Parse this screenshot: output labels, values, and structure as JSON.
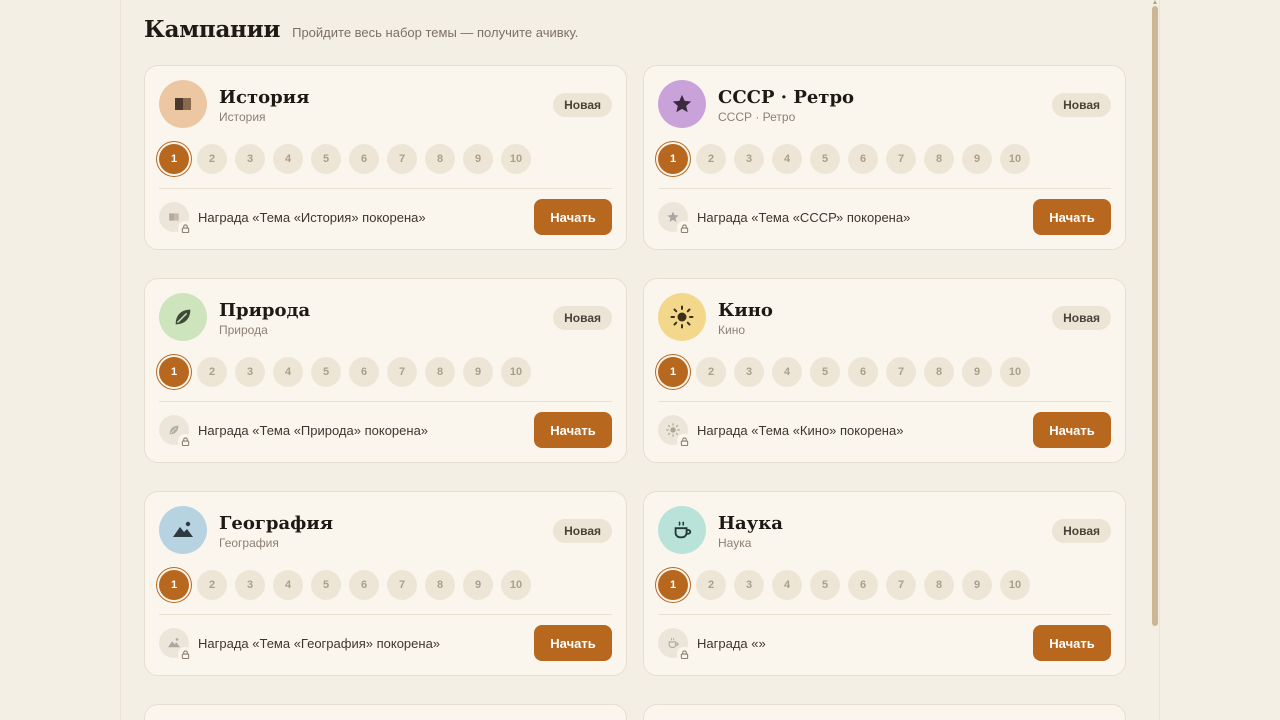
{
  "header": {
    "title": "Кампании",
    "subtitle": "Пройдите весь набор темы — получите ачивку."
  },
  "levels": [
    "1",
    "2",
    "3",
    "4",
    "5",
    "6",
    "7",
    "8",
    "9",
    "10"
  ],
  "cards": [
    {
      "title": "История",
      "subtitle": "История",
      "badge": "Новая",
      "icon": "book-icon",
      "icon_bg": "#ecc7a2",
      "reward": "Награда «Тема «История» покорена»",
      "button": "Начать"
    },
    {
      "title": "СССР · Ретро",
      "subtitle": "СССР · Ретро",
      "badge": "Новая",
      "icon": "star-icon",
      "icon_bg": "#c9a2d9",
      "reward": "Награда «Тема «СССР» покорена»",
      "button": "Начать"
    },
    {
      "title": "Природа",
      "subtitle": "Природа",
      "badge": "Новая",
      "icon": "leaf-icon",
      "icon_bg": "#cde4bd",
      "reward": "Награда «Тема «Природа» покорена»",
      "button": "Начать"
    },
    {
      "title": "Кино",
      "subtitle": "Кино",
      "badge": "Новая",
      "icon": "sun-icon",
      "icon_bg": "#f3d88c",
      "reward": "Награда «Тема «Кино» покорена»",
      "button": "Начать"
    },
    {
      "title": "География",
      "subtitle": "География",
      "badge": "Новая",
      "icon": "mountain-icon",
      "icon_bg": "#b7d3e2",
      "reward": "Награда «Тема «География» покорена»",
      "button": "Начать"
    },
    {
      "title": "Наука",
      "subtitle": "Наука",
      "badge": "Новая",
      "icon": "cup-icon",
      "icon_bg": "#b9e3d9",
      "reward": "Награда «»",
      "button": "Начать"
    }
  ],
  "colors": {
    "accent": "#b8671f",
    "background": "#f4efe4",
    "card": "#faf6ee"
  }
}
